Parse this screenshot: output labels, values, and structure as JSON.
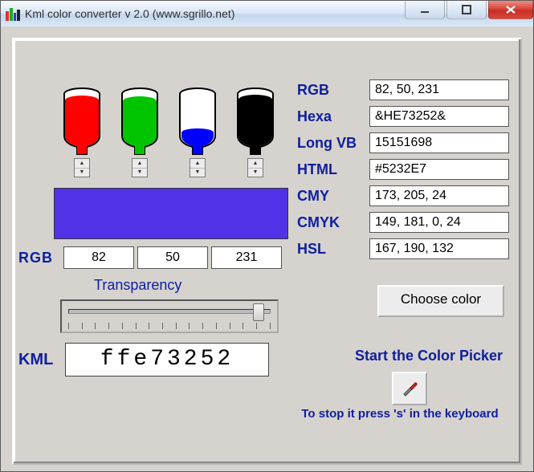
{
  "window": {
    "title": "Kml color converter v 2.0 (www.sgrillo.net)"
  },
  "bottles": [
    {
      "name": "red",
      "fill_color": "#ff0000",
      "fill_level": 0.85
    },
    {
      "name": "green",
      "fill_color": "#00c400",
      "fill_level": 0.82
    },
    {
      "name": "blue",
      "fill_color": "#0000ff",
      "fill_level": 0.18
    },
    {
      "name": "black",
      "fill_color": "#000000",
      "fill_level": 0.88
    }
  ],
  "preview_color": "#5232E7",
  "rgb_row": {
    "label": "RGB",
    "r": "82",
    "g": "50",
    "b": "231"
  },
  "transparency": {
    "label": "Transparency",
    "position_pct": 96
  },
  "kml": {
    "label": "KML",
    "value": "ffe73252"
  },
  "readouts": {
    "RGB": "82, 50, 231",
    "Hexa": "&HE73252&",
    "Long VB": "15151698",
    "HTML": "#5232E7",
    "CMY": "173, 205, 24",
    "CMYK": "149, 181, 0, 24",
    "HSL": "167, 190, 132"
  },
  "choose_button": "Choose color",
  "picker": {
    "label": "Start the Color Picker",
    "stop_hint": "To stop it press 's' in the keyboard"
  }
}
